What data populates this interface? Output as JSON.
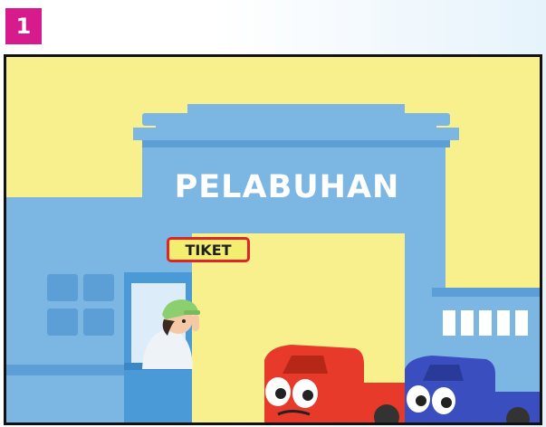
{
  "badge": {
    "number": "1"
  },
  "scene": {
    "gate_title": "PELABUHAN",
    "ticket_sign": "TIKET",
    "colors": {
      "sky": "#f8ef8d",
      "building": "#7cb7e4",
      "building_dark": "#5c9fd6",
      "badge": "#d81b8c",
      "sign_border": "#e0242b",
      "truck_red": "#e83a2a",
      "truck_blue": "#3b4ec0"
    }
  }
}
